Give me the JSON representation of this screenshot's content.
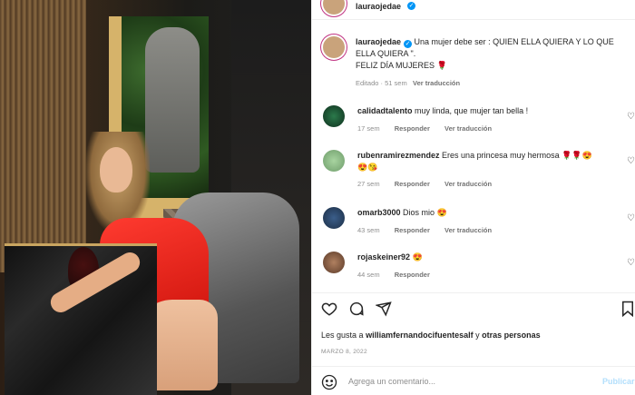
{
  "post": {
    "author": "lauraojedae",
    "caption_line1": "Una mujer debe ser : QUIEN ELLA QUIERA Y LO QUE ELLA QUIERA \".",
    "caption_line2": "FELIZ DÍA MUJERES 🌹",
    "edited_label": "Editado",
    "age": "51 sem",
    "translate": "Ver traducción"
  },
  "comments": [
    {
      "user": "calidadtalento",
      "text": "muy linda, que mujer tan bella !",
      "age": "17 sem",
      "reply": "Responder",
      "translate": "Ver traducción"
    },
    {
      "user": "rubenramirezmendez",
      "text": "Eres una princesa muy hermosa 🌹🌹😍",
      "text2": "😍😘",
      "age": "27 sem",
      "reply": "Responder",
      "translate": "Ver traducción"
    },
    {
      "user": "omarb3000",
      "text": "Dios mio 😍",
      "age": "43 sem",
      "reply": "Responder",
      "translate": "Ver traducción"
    },
    {
      "user": "rojaskeiner92",
      "text": "😍",
      "age": "44 sem",
      "reply": "Responder"
    }
  ],
  "likes": {
    "prefix": "Les gusta a",
    "user": "williamfernandocifuentesalf",
    "joiner": "y",
    "others": "otras personas"
  },
  "date": "MARZO 8, 2022",
  "add_comment": {
    "placeholder": "Agrega un comentario...",
    "publish": "Publicar"
  },
  "icons": [
    "heart-icon",
    "comment-icon",
    "share-icon",
    "save-icon",
    "emoji-icon",
    "verified-icon"
  ],
  "colors": {
    "accent": "#0095f6",
    "publish_disabled": "#b2dffc",
    "muted": "#8e8e8e"
  }
}
